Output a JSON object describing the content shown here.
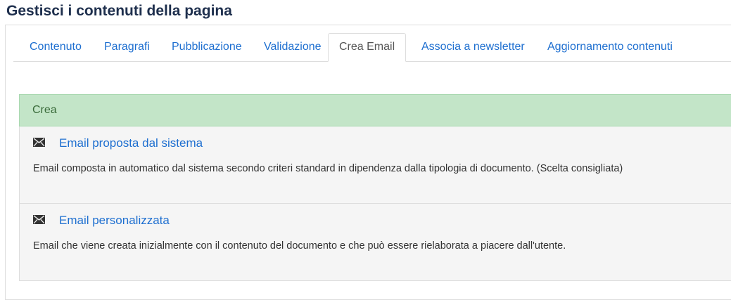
{
  "page_title": "Gestisci i contenuti della pagina",
  "tabs": [
    {
      "label": "Contenuto"
    },
    {
      "label": "Paragrafi"
    },
    {
      "label": "Pubblicazione"
    },
    {
      "label": "Validazione"
    },
    {
      "label": "Crea Email",
      "active": true
    },
    {
      "label": "Associa a newsletter"
    },
    {
      "label": "Aggiornamento contenuti"
    }
  ],
  "create_group": {
    "header": "Crea",
    "items": [
      {
        "icon": "envelope-icon",
        "title": "Email proposta dal sistema",
        "description": "Email composta in automatico dal sistema secondo criteri standard in dipendenza dalla tipologia di documento. (Scelta consigliata)"
      },
      {
        "icon": "envelope-icon",
        "title": "Email personalizzata",
        "description": "Email che viene creata inizialmente con il contenuto del documento e che può essere rielaborata a piacere dall'utente."
      }
    ]
  },
  "colors": {
    "link": "#1e6fd0",
    "title": "#1e2f4d",
    "header_bg": "#c3e5c8",
    "item_bg": "#f5f5f5"
  }
}
